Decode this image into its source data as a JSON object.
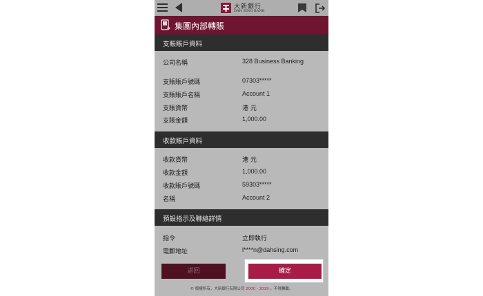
{
  "topbar": {
    "logo_cn": "大新銀行",
    "logo_en": "DAH SING BANK"
  },
  "header": {
    "title": "集團內部轉賬"
  },
  "from_section": {
    "title": "支賬賬戶資料",
    "rows": [
      {
        "label": "公司名稱",
        "value": "328 Business Banking"
      },
      {
        "label": "支賬賬戶號碼",
        "value": "07303*****"
      },
      {
        "label": "支賬賬戶名稱",
        "value": "Account 1"
      },
      {
        "label": "支賬貨幣",
        "value": "港 元"
      },
      {
        "label": "支賬金額",
        "value": "1,000.00"
      }
    ]
  },
  "to_section": {
    "title": "收款賬戶資料",
    "rows": [
      {
        "label": "收款貨幣",
        "value": "港 元"
      },
      {
        "label": "收款金額",
        "value": "1,000.00"
      },
      {
        "label": "收款賬戶號碼",
        "value": "59303*****"
      },
      {
        "label": "名稱",
        "value": "Account 2"
      }
    ]
  },
  "contact_section": {
    "title": "預設指示及聯絡詳情",
    "rows": [
      {
        "label": "指令",
        "value": "立即執行"
      },
      {
        "label": "電郵地址",
        "value": "l****n@dahsing.com"
      }
    ]
  },
  "buttons": {
    "back": "返回",
    "confirm": "確定"
  },
  "footer": {
    "prefix": "© 版權所有，大新銀行有限公司 ",
    "years": "2000 - 2019",
    "suffix": " 。不得轉載。"
  },
  "colors": {
    "brand": "#6d1531",
    "confirm": "#a81d48",
    "section_bg": "#2e2e2e"
  }
}
